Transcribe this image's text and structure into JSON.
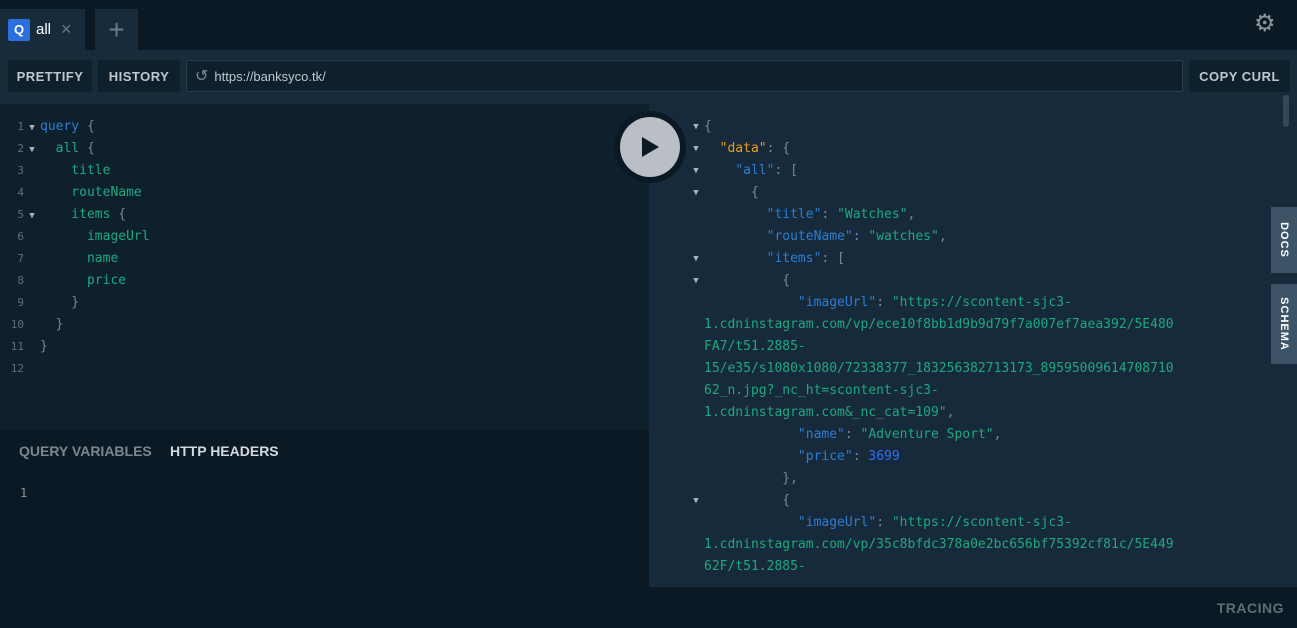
{
  "tabs": [
    {
      "badge": "Q",
      "label": "all",
      "close": "×"
    }
  ],
  "new_tab": "+",
  "settings_icon": "gear-icon",
  "toolbar": {
    "prettify": "PRETTIFY",
    "history": "HISTORY",
    "url": "https://banksyco.tk/",
    "copy_curl": "COPY CURL"
  },
  "query_lines": [
    {
      "n": "1",
      "fold": true,
      "tokens": [
        [
          "kw",
          "query"
        ],
        [
          "pn",
          " {"
        ]
      ]
    },
    {
      "n": "2",
      "fold": true,
      "tokens": [
        [
          "fd",
          "  all"
        ],
        [
          "pn",
          " {"
        ]
      ]
    },
    {
      "n": "3",
      "fold": false,
      "tokens": [
        [
          "fd",
          "    title"
        ]
      ]
    },
    {
      "n": "4",
      "fold": false,
      "tokens": [
        [
          "fd",
          "    routeName"
        ]
      ]
    },
    {
      "n": "5",
      "fold": true,
      "tokens": [
        [
          "fd",
          "    items"
        ],
        [
          "pn",
          " {"
        ]
      ]
    },
    {
      "n": "6",
      "fold": false,
      "tokens": [
        [
          "fd",
          "      imageUrl"
        ]
      ]
    },
    {
      "n": "7",
      "fold": false,
      "tokens": [
        [
          "fd",
          "      name"
        ]
      ]
    },
    {
      "n": "8",
      "fold": false,
      "tokens": [
        [
          "fd",
          "      price"
        ]
      ]
    },
    {
      "n": "9",
      "fold": false,
      "tokens": [
        [
          "pn",
          "    }"
        ]
      ]
    },
    {
      "n": "10",
      "fold": false,
      "tokens": [
        [
          "pn",
          "  }"
        ]
      ]
    },
    {
      "n": "11",
      "fold": false,
      "tokens": [
        [
          "pn",
          "}"
        ]
      ]
    },
    {
      "n": "12",
      "fold": false,
      "tokens": []
    }
  ],
  "variables": {
    "query_variables": "QUERY VARIABLES",
    "http_headers": "HTTP HEADERS",
    "line_number": "1"
  },
  "result_lines": [
    {
      "fold": true,
      "tokens": [
        [
          "pn",
          "{"
        ]
      ]
    },
    {
      "fold": true,
      "tokens": [
        [
          "pn",
          "  "
        ],
        [
          "dkey",
          "\"data\""
        ],
        [
          "pn",
          ": {"
        ]
      ]
    },
    {
      "fold": true,
      "tokens": [
        [
          "pn",
          "    "
        ],
        [
          "key",
          "\"all\""
        ],
        [
          "pn",
          ": ["
        ]
      ]
    },
    {
      "fold": true,
      "tokens": [
        [
          "pn",
          "      {"
        ]
      ]
    },
    {
      "fold": false,
      "tokens": [
        [
          "pn",
          "        "
        ],
        [
          "key",
          "\"title\""
        ],
        [
          "pn",
          ": "
        ],
        [
          "str",
          "\"Watches\""
        ],
        [
          "pn",
          ","
        ]
      ]
    },
    {
      "fold": false,
      "tokens": [
        [
          "pn",
          "        "
        ],
        [
          "key",
          "\"routeName\""
        ],
        [
          "pn",
          ": "
        ],
        [
          "str",
          "\"watches\""
        ],
        [
          "pn",
          ","
        ]
      ]
    },
    {
      "fold": true,
      "tokens": [
        [
          "pn",
          "        "
        ],
        [
          "key",
          "\"items\""
        ],
        [
          "pn",
          ": ["
        ]
      ]
    },
    {
      "fold": true,
      "tokens": [
        [
          "pn",
          "          {"
        ]
      ]
    },
    {
      "fold": false,
      "tokens": [
        [
          "pn",
          "            "
        ],
        [
          "key",
          "\"imageUrl\""
        ],
        [
          "pn",
          ": "
        ],
        [
          "str",
          "\"https://scontent-sjc3-"
        ]
      ]
    },
    {
      "fold": false,
      "tokens": [
        [
          "str",
          "1.cdninstagram.com/vp/ece10f8bb1d9b9d79f7a007ef7aea392/5E480"
        ]
      ]
    },
    {
      "fold": false,
      "tokens": [
        [
          "str",
          "FA7/t51.2885-"
        ]
      ]
    },
    {
      "fold": false,
      "tokens": [
        [
          "str",
          "15/e35/s1080x1080/72338377_183256382713173_89595009614708710"
        ]
      ]
    },
    {
      "fold": false,
      "tokens": [
        [
          "str",
          "62_n.jpg?_nc_ht=scontent-sjc3-"
        ]
      ]
    },
    {
      "fold": false,
      "tokens": [
        [
          "str",
          "1.cdninstagram.com&_nc_cat=109\""
        ],
        [
          "pn",
          ","
        ]
      ]
    },
    {
      "fold": false,
      "tokens": [
        [
          "pn",
          "            "
        ],
        [
          "key",
          "\"name\""
        ],
        [
          "pn",
          ": "
        ],
        [
          "str",
          "\"Adventure Sport\""
        ],
        [
          "pn",
          ","
        ]
      ]
    },
    {
      "fold": false,
      "tokens": [
        [
          "pn",
          "            "
        ],
        [
          "key",
          "\"price\""
        ],
        [
          "pn",
          ": "
        ],
        [
          "num",
          "3699"
        ]
      ]
    },
    {
      "fold": false,
      "tokens": [
        [
          "pn",
          "          },"
        ]
      ]
    },
    {
      "fold": true,
      "tokens": [
        [
          "pn",
          "          {"
        ]
      ]
    },
    {
      "fold": false,
      "tokens": [
        [
          "pn",
          "            "
        ],
        [
          "key",
          "\"imageUrl\""
        ],
        [
          "pn",
          ": "
        ],
        [
          "str",
          "\"https://scontent-sjc3-"
        ]
      ]
    },
    {
      "fold": false,
      "tokens": [
        [
          "str",
          "1.cdninstagram.com/vp/35c8bfdc378a0e2bc656bf75392cf81c/5E449"
        ]
      ]
    },
    {
      "fold": false,
      "tokens": [
        [
          "str",
          "62F/t51.2885-"
        ]
      ]
    }
  ],
  "side_tabs": {
    "docs": "DOCS",
    "schema": "SCHEMA"
  },
  "bottom": {
    "tracing": "TRACING"
  },
  "colors": {
    "accent": "#2b6fdc",
    "keyword": "#2a7ed2",
    "field": "#1ea87f",
    "data_key": "#f09a1d",
    "number": "#2f6ff5"
  }
}
